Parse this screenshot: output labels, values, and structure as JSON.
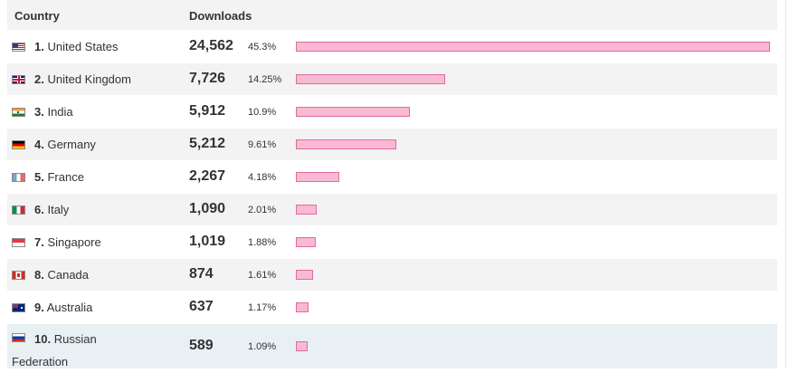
{
  "header": {
    "country_label": "Country",
    "downloads_label": "Downloads"
  },
  "colors": {
    "bar_fill": "#f9b9d4",
    "bar_border": "#de6c9e",
    "row_alt": "#f3f3f3",
    "row_highlight": "#e8f0f4"
  },
  "rows": [
    {
      "rank": "1.",
      "name": "United States",
      "downloads": "24,562",
      "percent": "45.3%",
      "share": 45.3,
      "flag": "us-flag-icon"
    },
    {
      "rank": "2.",
      "name": "United Kingdom",
      "downloads": "7,726",
      "percent": "14.25%",
      "share": 14.25,
      "flag": "uk-flag-icon"
    },
    {
      "rank": "3.",
      "name": "India",
      "downloads": "5,912",
      "percent": "10.9%",
      "share": 10.9,
      "flag": "india-flag-icon"
    },
    {
      "rank": "4.",
      "name": "Germany",
      "downloads": "5,212",
      "percent": "9.61%",
      "share": 9.61,
      "flag": "germany-flag-icon"
    },
    {
      "rank": "5.",
      "name": "France",
      "downloads": "2,267",
      "percent": "4.18%",
      "share": 4.18,
      "flag": "france-flag-icon"
    },
    {
      "rank": "6.",
      "name": "Italy",
      "downloads": "1,090",
      "percent": "2.01%",
      "share": 2.01,
      "flag": "italy-flag-icon"
    },
    {
      "rank": "7.",
      "name": "Singapore",
      "downloads": "1,019",
      "percent": "1.88%",
      "share": 1.88,
      "flag": "singapore-flag-icon"
    },
    {
      "rank": "8.",
      "name": "Canada",
      "downloads": "874",
      "percent": "1.61%",
      "share": 1.61,
      "flag": "canada-flag-icon"
    },
    {
      "rank": "9.",
      "name": "Australia",
      "downloads": "637",
      "percent": "1.17%",
      "share": 1.17,
      "flag": "australia-flag-icon"
    },
    {
      "rank": "10.",
      "name": "Russian Federation",
      "downloads": "589",
      "percent": "1.09%",
      "share": 1.09,
      "flag": "russia-flag-icon"
    }
  ]
}
